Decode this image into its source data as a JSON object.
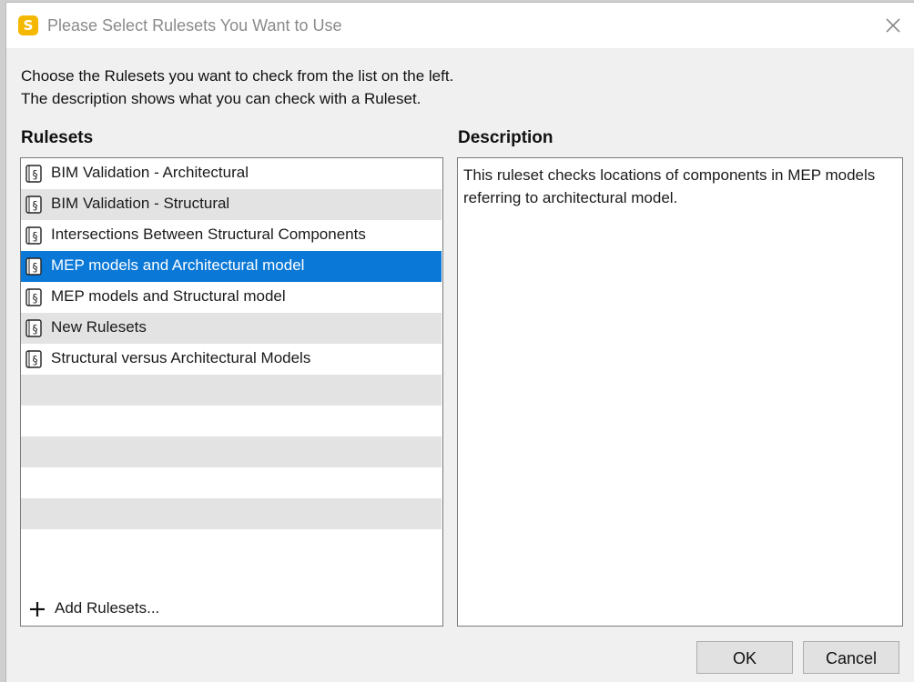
{
  "window": {
    "title": "Please Select Rulesets You Want to Use",
    "app_icon_letter": "S"
  },
  "instructions": {
    "line1": "Choose the Rulesets you want to check from the list on the left.",
    "line2": "The description shows what you can check with a Ruleset."
  },
  "rulesets": {
    "label": "Rulesets",
    "items": [
      {
        "label": "BIM Validation - Architectural"
      },
      {
        "label": "BIM Validation - Structural"
      },
      {
        "label": "Intersections Between Structural Components"
      },
      {
        "label": "MEP models and Architectural model",
        "selected": true
      },
      {
        "label": "MEP models and Structural model"
      },
      {
        "label": "New Rulesets"
      },
      {
        "label": "Structural versus Architectural Models"
      }
    ],
    "add_label": "Add Rulesets..."
  },
  "description": {
    "label": "Description",
    "text": "This ruleset checks locations of components in MEP models referring to architectural model."
  },
  "buttons": {
    "ok": "OK",
    "cancel": "Cancel"
  },
  "colors": {
    "selection": "#0a78d7",
    "alt_row": "#e3e3e3",
    "app_icon": "#f5b800"
  }
}
